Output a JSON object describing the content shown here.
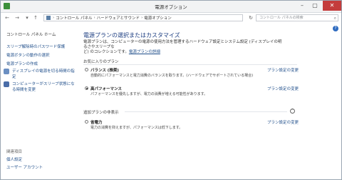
{
  "window": {
    "title": "電源オプション"
  },
  "address": {
    "crumbs": [
      "コントロール パネル",
      "ハードウェアとサウンド",
      "電源オプション"
    ]
  },
  "search": {
    "placeholder": "コントロール パネルの検索"
  },
  "left_nav": {
    "home": "コントロール パネル ホーム",
    "items": [
      "スリープ解除時のパスワード保護",
      "電源ボタンの動作の選択",
      "電源プランの作成",
      "ディスプレイの電源を切る時間の指定",
      "コンピューターがスリープ状態になる時間を変更"
    ],
    "related_heading": "関連項目",
    "related": [
      "個人設定",
      "ユーザー アカウント"
    ]
  },
  "main": {
    "heading": "電源プランの選択またはカスタマイズ",
    "desc_line1": "電源プランは、コンピューターの電源の使用方法を管理するハードウェア設定とシステム設定 (ディスプレイの明るさやスリープな",
    "desc_line2": "ど) のコレクションです。",
    "desc_link": "電源プランの詳細",
    "favorites_label": "お気に入りのプラン",
    "plans": [
      {
        "name": "バランス (推奨)",
        "desc": "自動的にパフォーマンスと電力消費のバランスを取ります。(ハードウェアでサポートされている場合)",
        "change": "プラン設定の変更"
      },
      {
        "name": "高パフォーマンス",
        "desc": "パフォーマンスを優先しますが、電力の消費が増える可能性があります。",
        "change": "プラン設定の変更"
      }
    ],
    "hidden_label": "追加プランの非表示",
    "hidden_plans": [
      {
        "name": "省電力",
        "desc": "電力の消費を抑えますが、パフォーマンスは低下します。",
        "change": "プラン設定の変更"
      }
    ]
  }
}
